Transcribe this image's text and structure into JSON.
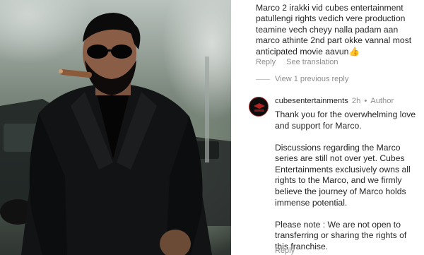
{
  "top_comment": {
    "text": "Marco 2 irakki vid cubes entertainment patullengi rights vedich vere production teamine vech cheyy nalla padam aan marco athinte 2nd part okke vannal most anticipated movie aavun👍",
    "reply_label": "Reply",
    "translation_label": "See translation"
  },
  "view_previous_label": "View 1 previous reply",
  "author_reply": {
    "username": "cubesentertainments",
    "time": "2h",
    "separator": "•",
    "author_badge": "Author",
    "paragraphs": [
      "Thank you for the overwhelming love and support for Marco.",
      "Discussions regarding the Marco series are still not over yet. Cubes Entertainments exclusively owns all rights to the Marco, and we firmly believe the journey of Marco holds immense potential.",
      "Please note : We are not open to transferring or sharing the rights of this franchise."
    ],
    "reply_label": "Reply"
  },
  "colors": {
    "text": "#262626",
    "muted": "#8e8e8e",
    "divider": "#c7c7c7"
  }
}
